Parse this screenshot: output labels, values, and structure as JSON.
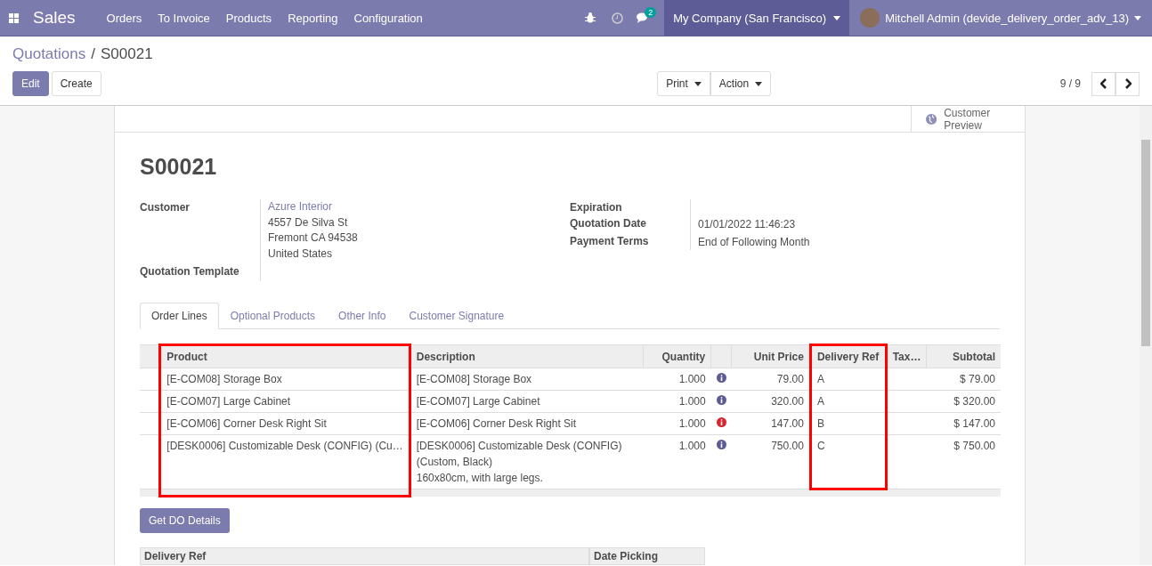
{
  "navbar": {
    "app": "Sales",
    "menu": [
      "Orders",
      "To Invoice",
      "Products",
      "Reporting",
      "Configuration"
    ],
    "messages_count": "2",
    "company": "My Company (San Francisco)",
    "user": "Mitchell Admin (devide_delivery_order_adv_13)"
  },
  "breadcrumb": {
    "parent": "Quotations",
    "separator": "/",
    "current": "S00021"
  },
  "buttons": {
    "edit": "Edit",
    "create": "Create",
    "print": "Print",
    "action": "Action"
  },
  "pager": "9 / 9",
  "sheet": {
    "preview_button": "Customer Preview",
    "title": "S00021",
    "left_fields": [
      {
        "label": "Customer",
        "lines": [
          "Azure Interior",
          "4557 De Silva St",
          "Fremont CA 94538",
          "United States"
        ]
      },
      {
        "label": "Quotation Template"
      }
    ],
    "right_fields": [
      {
        "label": "Expiration"
      },
      {
        "label": "Quotation Date",
        "value": "01/01/2022 11:46:23"
      },
      {
        "label": "Payment Terms",
        "value": "End of Following Month"
      }
    ],
    "tabs": [
      {
        "label": "Order Lines",
        "selected": true
      },
      {
        "label": "Optional Products",
        "selected": false
      },
      {
        "label": "Other Info",
        "selected": false
      },
      {
        "label": "Customer Signature",
        "selected": false
      }
    ],
    "columns": [
      {
        "label": "Product",
        "highlighted": true
      },
      {
        "label": "Description",
        "highlighted": false
      },
      {
        "label": "Quantity",
        "highlighted": false
      },
      {
        "label": "Unit Price",
        "highlighted": false
      },
      {
        "label": "Delivery Ref",
        "highlighted": true
      },
      {
        "label": "Tax…",
        "highlighted": false
      },
      {
        "label": "Subtotal",
        "highlighted": false
      }
    ],
    "rows": [
      {
        "product": "[E-COM08] Storage Box",
        "description": [
          "[E-COM08] Storage Box"
        ],
        "quantity": "1.000",
        "warning": false,
        "unit_price": "79.00",
        "delivery_ref": "A",
        "subtotal": "$ 79.00"
      },
      {
        "product": "[E-COM07] Large Cabinet",
        "description": [
          "[E-COM07] Large Cabinet"
        ],
        "quantity": "1.000",
        "warning": false,
        "unit_price": "320.00",
        "delivery_ref": "A",
        "subtotal": "$ 320.00"
      },
      {
        "product": "[E-COM06] Corner Desk Right Sit",
        "description": [
          "[E-COM06] Corner Desk Right Sit"
        ],
        "quantity": "1.000",
        "warning": true,
        "unit_price": "147.00",
        "delivery_ref": "B",
        "subtotal": "$ 147.00"
      },
      {
        "product": "[DESK0006] Customizable Desk (CONFIG) (Cu…",
        "description": [
          "[DESK0006] Customizable Desk (CONFIG)",
          "(Custom, Black)",
          "160x80cm, with large legs."
        ],
        "quantity": "1.000",
        "warning": false,
        "unit_price": "750.00",
        "delivery_ref": "C",
        "subtotal": "$ 750.00"
      }
    ],
    "do_button": "Get DO Details",
    "do_columns": [
      "Delivery Ref",
      "Date Picking"
    ]
  }
}
